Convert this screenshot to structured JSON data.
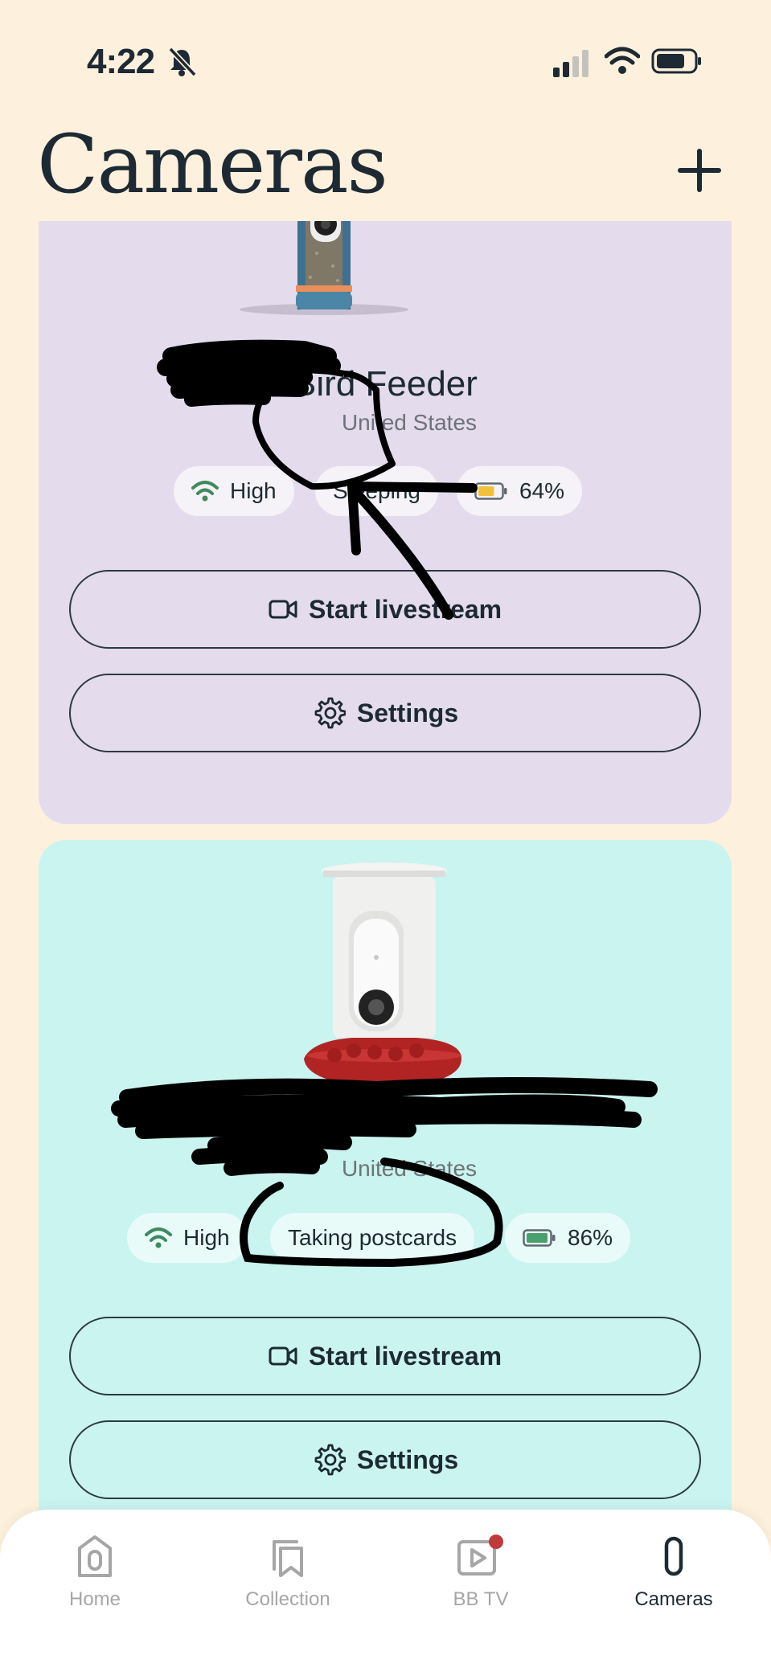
{
  "status_bar": {
    "time": "4:22"
  },
  "header": {
    "title": "Cameras"
  },
  "cameras": [
    {
      "name": "Bird Feeder",
      "location": "United States",
      "chips": {
        "wifi": "High",
        "status": "Sleeping",
        "battery": "64%"
      },
      "battery_level": 0.64,
      "accent_color": "#e4dced",
      "livestream_label": "Start livestream",
      "settings_label": "Settings"
    },
    {
      "name": "",
      "location": "United States",
      "chips": {
        "wifi": "High",
        "status": "Taking postcards",
        "battery": "86%"
      },
      "battery_level": 0.86,
      "accent_color": "#caf4f0",
      "livestream_label": "Start livestream",
      "settings_label": "Settings"
    }
  ],
  "tab_bar": {
    "tabs": [
      {
        "label": "Home",
        "icon": "home-icon"
      },
      {
        "label": "Collection",
        "icon": "collection-icon"
      },
      {
        "label": "BB TV",
        "icon": "tv-play-icon",
        "badge_color": "#c0393b"
      },
      {
        "label": "Cameras",
        "icon": "camera-device-icon",
        "active": true
      }
    ]
  }
}
